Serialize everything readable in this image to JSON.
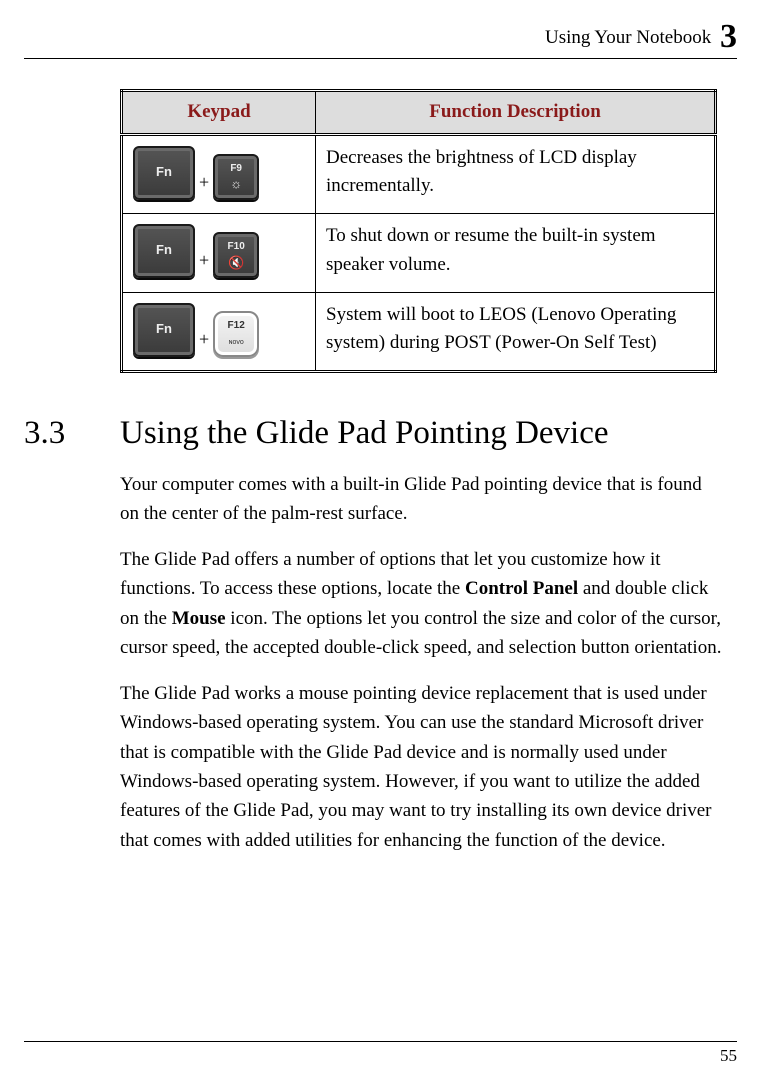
{
  "header": {
    "running_title": "Using Your Notebook",
    "chapter_number": "3"
  },
  "table": {
    "col1": "Keypad",
    "col2": "Function Description",
    "rows": [
      {
        "key1_label": "Fn",
        "plus": "+",
        "key2_top": "F9",
        "key2_iconname": "brightness-down-icon",
        "key2_glyph": "☼",
        "key2_style": "dark",
        "desc": "Decreases the brightness of LCD display incrementally."
      },
      {
        "key1_label": "Fn",
        "plus": "+",
        "key2_top": "F10",
        "key2_iconname": "mute-icon",
        "key2_glyph": "🔇",
        "key2_style": "dark",
        "desc": "To shut down or resume the built-in system speaker volume."
      },
      {
        "key1_label": "Fn",
        "plus": "+",
        "key2_top": "F12",
        "key2_iconname": "novo-icon",
        "key2_glyph": "ɴᴏᴠᴏ",
        "key2_style": "light",
        "desc": "System will boot to LEOS (Lenovo Operating system) during POST (Power-On Self Test)"
      }
    ]
  },
  "section": {
    "number": "3.3",
    "title": "Using the Glide Pad Pointing Device",
    "p1": "Your computer comes with a built-in Glide Pad pointing device that is found on the center of the palm-rest surface.",
    "p2a": "The Glide Pad offers a number of options that let you customize how it functions. To access these options, locate the ",
    "p2_bold1": "Control Panel",
    "p2b": " and double click on the ",
    "p2_bold2": "Mouse",
    "p2c": " icon. The options let you control the size and color of the cursor, cursor speed, the accepted double-click speed, and selection button orientation.",
    "p3": "The Glide Pad works a mouse pointing device replacement that is used under Windows-based operating system. You can use the standard Microsoft driver that is compatible with the Glide Pad device and is normally used under Windows-based operating system. However, if you want to utilize the added features of the Glide Pad, you may want to try installing its own device driver that comes with added utilities for enhancing the function of the device."
  },
  "footer": {
    "page_number": "55"
  }
}
